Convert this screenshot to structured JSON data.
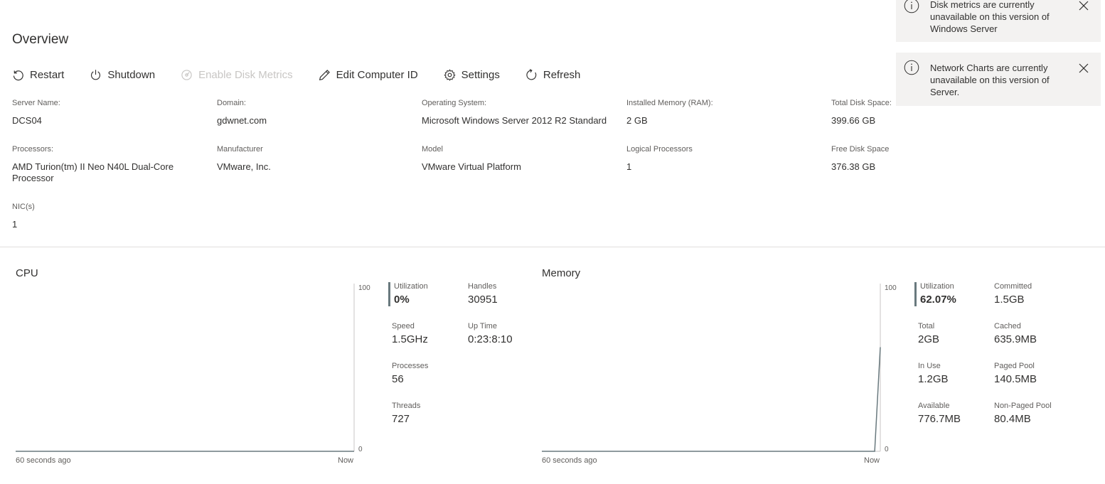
{
  "page": {
    "title": "Overview"
  },
  "toolbar": {
    "restart": "Restart",
    "shutdown": "Shutdown",
    "enable_disk_metrics": "Enable Disk Metrics",
    "edit_computer_id": "Edit Computer ID",
    "settings": "Settings",
    "refresh": "Refresh"
  },
  "properties": {
    "server_name": {
      "label": "Server Name:",
      "value": "DCS04"
    },
    "domain": {
      "label": "Domain:",
      "value": "gdwnet.com"
    },
    "os": {
      "label": "Operating System:",
      "value": "Microsoft Windows Server 2012 R2 Standard"
    },
    "ram": {
      "label": "Installed Memory (RAM):",
      "value": "2 GB"
    },
    "total_disk": {
      "label": "Total Disk Space:",
      "value": "399.66 GB"
    },
    "processors": {
      "label": "Processors:",
      "value": "AMD Turion(tm) II Neo N40L Dual-Core Processor"
    },
    "manufacturer": {
      "label": "Manufacturer",
      "value": "VMware, Inc."
    },
    "model": {
      "label": "Model",
      "value": "VMware Virtual Platform"
    },
    "logical_processors": {
      "label": "Logical Processors",
      "value": "1"
    },
    "free_disk": {
      "label": "Free Disk Space",
      "value": "376.38 GB"
    },
    "nics": {
      "label": "NIC(s)",
      "value": "1"
    }
  },
  "cpu": {
    "title": "CPU",
    "axis_max": "100",
    "axis_min": "0",
    "x_start": "60 seconds ago",
    "x_end": "Now",
    "stats": {
      "utilization": {
        "label": "Utilization",
        "value": "0%"
      },
      "handles": {
        "label": "Handles",
        "value": "30951"
      },
      "speed": {
        "label": "Speed",
        "value": "1.5GHz"
      },
      "uptime": {
        "label": "Up Time",
        "value": "0:23:8:10"
      },
      "processes": {
        "label": "Processes",
        "value": "56"
      },
      "threads": {
        "label": "Threads",
        "value": "727"
      }
    }
  },
  "memory": {
    "title": "Memory",
    "axis_max": "100",
    "axis_min": "0",
    "x_start": "60 seconds ago",
    "x_end": "Now",
    "stats": {
      "utilization": {
        "label": "Utilization",
        "value": "62.07%"
      },
      "committed": {
        "label": "Committed",
        "value": "1.5GB"
      },
      "total": {
        "label": "Total",
        "value": "2GB"
      },
      "cached": {
        "label": "Cached",
        "value": "635.9MB"
      },
      "in_use": {
        "label": "In Use",
        "value": "1.2GB"
      },
      "paged_pool": {
        "label": "Paged Pool",
        "value": "140.5MB"
      },
      "available": {
        "label": "Available",
        "value": "776.7MB"
      },
      "non_paged_pool": {
        "label": "Non-Paged Pool",
        "value": "80.4MB"
      }
    }
  },
  "chart_data": [
    {
      "type": "line",
      "name": "CPU",
      "ylim": [
        0,
        100
      ],
      "x": [
        0,
        59,
        60
      ],
      "values": [
        0,
        0,
        0
      ]
    },
    {
      "type": "line",
      "name": "Memory",
      "ylim": [
        0,
        100
      ],
      "x": [
        0,
        59,
        60
      ],
      "values": [
        0,
        0,
        62.07
      ]
    }
  ],
  "notifications": [
    {
      "text": "Disk metrics are currently unavailable on this version of Windows Server"
    },
    {
      "text": "Network Charts are currently unavailable on this version of Server."
    }
  ],
  "colors": {
    "chart_line": "#69797e",
    "toast_bg": "#f3f2f1",
    "disabled_text": "#c8c6c4"
  },
  "icons": [
    "restart-icon",
    "power-icon",
    "disk-icon",
    "pencil-icon",
    "gear-icon",
    "refresh-icon",
    "info-icon",
    "close-icon"
  ]
}
